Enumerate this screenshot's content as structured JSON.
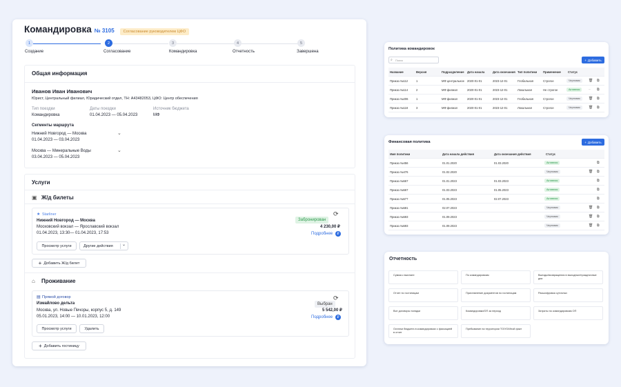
{
  "trip": {
    "title": "Командировка",
    "number": "№ 3105",
    "status_badge": "Согласование руководителем ЦФО",
    "steps": [
      {
        "n": "1",
        "label": "Создание"
      },
      {
        "n": "2",
        "label": "Согласование"
      },
      {
        "n": "3",
        "label": "Командировка"
      },
      {
        "n": "4",
        "label": "Отчетность"
      },
      {
        "n": "5",
        "label": "Завершена"
      }
    ],
    "general": {
      "heading": "Общая информация",
      "employee_name": "Иванов Иван Иванович",
      "employee_details": "Юрист, Центральный филиал, Юридический отдел, ТН: А43482053, ЦФО: Центр обеспечения",
      "trip_type_label": "Тип поездки",
      "trip_type": "Командировка",
      "dates_label": "Даты поездки",
      "dates": "01.04.2023 — 05.04.2023",
      "budget_label": "Источник бюджета",
      "budget": "МФ",
      "segments_label": "Сегменты маршрута",
      "segments": [
        {
          "route": "Нижний Новгород — Москва",
          "dates": "01.04.2023 — 03.04.2023"
        },
        {
          "route": "Москва — Минеральные Воды",
          "dates": "03.04.2023 — 05.04.2023"
        }
      ]
    },
    "services": {
      "heading": "Услуги",
      "rail": {
        "heading": "Ж/д билеты",
        "provider": "Starliner",
        "route": "Нижний Новгород — Москва",
        "stations": "Московский вокзал — Ярославский вокзал",
        "datetime": "01.04.2023, 13:30— 01.04.2023, 17:53",
        "status": "Забронирован",
        "price": "4 230,00 ₽",
        "details": "Подробнее",
        "view_button": "Просмотр услуги",
        "other_button": "Другие действия",
        "add_button": "Добавить Ж/д билет"
      },
      "hotel": {
        "heading": "Проживание",
        "contract": "Прямой договор",
        "name": "Измайлово дельта",
        "address": "Москва, ул. Новые Печоры, корпус 5, д. 149",
        "datetime": "05.01.2023, 14:00 — 10.01.2023, 12:00",
        "status": "Выбран",
        "price": "5 542,00 ₽",
        "details": "Подробнее",
        "view_button": "Просмотр услуги",
        "delete_button": "Удалить",
        "add_button": "Добавить гостиницу"
      }
    }
  },
  "trip_policy": {
    "title": "Политика командировок",
    "search_placeholder": "Поиск",
    "add_button": "Добавить",
    "columns": [
      "Название",
      "Версия",
      "Подразделение",
      "Дата начала",
      "Дата окончания",
      "Тип политики",
      "Применение",
      "Статус"
    ],
    "rows": [
      [
        "Приказ №112",
        "1",
        "МФ центральное",
        "2020-01-01",
        "2023-12-01",
        "Глобальная",
        "Строгое",
        "Черновик"
      ],
      [
        "Приказ №114",
        "2",
        "МФ филиал",
        "2020-01-01",
        "2023-12-01",
        "Локальная",
        "Не строгое",
        "Активная"
      ],
      [
        "Приказ №206",
        "1",
        "МФ филиал",
        "2020-01-01",
        "2023-12-01",
        "Глобальная",
        "Строгое",
        "Черновик"
      ],
      [
        "Приказ №118",
        "3",
        "МФ филиал",
        "2020-01-01",
        "2023-12-01",
        "Локальная",
        "Строгое",
        "Черновик"
      ]
    ]
  },
  "fin_policy": {
    "title": "Финансовая политика",
    "add_button": "Добавить",
    "columns": [
      "Имя политики",
      "Дата начала действия",
      "Дата окончания действия",
      "Статус"
    ],
    "rows": [
      [
        "Приказ №456",
        "01.01.2020",
        "01.03.2020",
        "Активная"
      ],
      [
        "Приказ №476",
        "01.02.2020",
        "",
        "Черновик"
      ],
      [
        "Приказ №567",
        "01.01.2023",
        "01.03.2023",
        "Активная"
      ],
      [
        "Приказ №567",
        "01.03.2023",
        "01.05.2023",
        "Активная"
      ],
      [
        "Приказ №577",
        "01.05.2023",
        "02.07.2023",
        "Активная"
      ],
      [
        "Приказ №581",
        "02.07.2023",
        "",
        "Черновик"
      ],
      [
        "Приказ №593",
        "01.09.2023",
        "",
        "Черновик"
      ],
      [
        "Приказ №593",
        "01.09.2023",
        "",
        "Черновик"
      ]
    ]
  },
  "reports": {
    "title": "Отчетность",
    "items": [
      "Сумма к выплате",
      "По командировкам",
      "Выезды/возвращения в выходные/праздничные дни",
      "Отчет по гостиницам",
      "Приставление документов по гостиницам",
      "Расшифровка суточных",
      "Все договоры поездки",
      "Командировки/ОП за период",
      "Затраты по командировкам ОП",
      "Остатки бюджета в командировках с фиксацией в отчет",
      "Пребывание на территории ТО/УО/Иной факт"
    ]
  }
}
